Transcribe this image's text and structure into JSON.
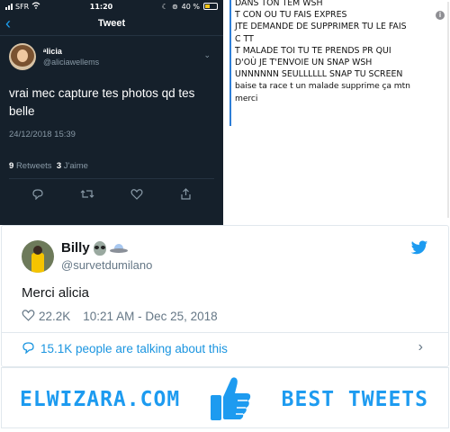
{
  "phone": {
    "status": {
      "carrier": "SFR",
      "time": "11:20",
      "battery": "40 %",
      "battery_level": 0.4
    },
    "nav": {
      "back": "‹",
      "title": "Tweet"
    },
    "tweet": {
      "name": "ᵃlicia",
      "handle": "@aliciawellems",
      "text": "vrai mec capture tes photos qd tes belle",
      "date": "24/12/2018 15:39",
      "retweets_count": "9",
      "retweets_label": "Retweets",
      "likes_count": "3",
      "likes_label": "J'aime"
    }
  },
  "messages": [
    "DANS TON TEM WSH",
    "T CON OU TU FAIS EXPRES",
    "JTE DEMANDE DE SUPPRIMER TU LE FAIS",
    "C TT",
    "T MALADE TOI TU TE PRENDS PR QUI",
    "D'OÙ JE T'ENVOIE UN SNAP WSH",
    "UNNNNNN SEULLLLLL SNAP TU SCREEN",
    "baise ta race t un malade supprime ça mtn",
    "merci"
  ],
  "card": {
    "name": "Billy",
    "handle": "@survetdumilano",
    "text": "Merci alicia",
    "likes": "22.2K",
    "time": "10:21 AM - Dec 25, 2018",
    "talking": "15.1K people are talking about this"
  },
  "footer": {
    "left": "ELWIZARA.COM",
    "right": "BEST TWEETS"
  },
  "colors": {
    "twitter_blue": "#1d9bf0",
    "dark_bg": "#15202b",
    "accent_line": "#2e7ed6"
  }
}
